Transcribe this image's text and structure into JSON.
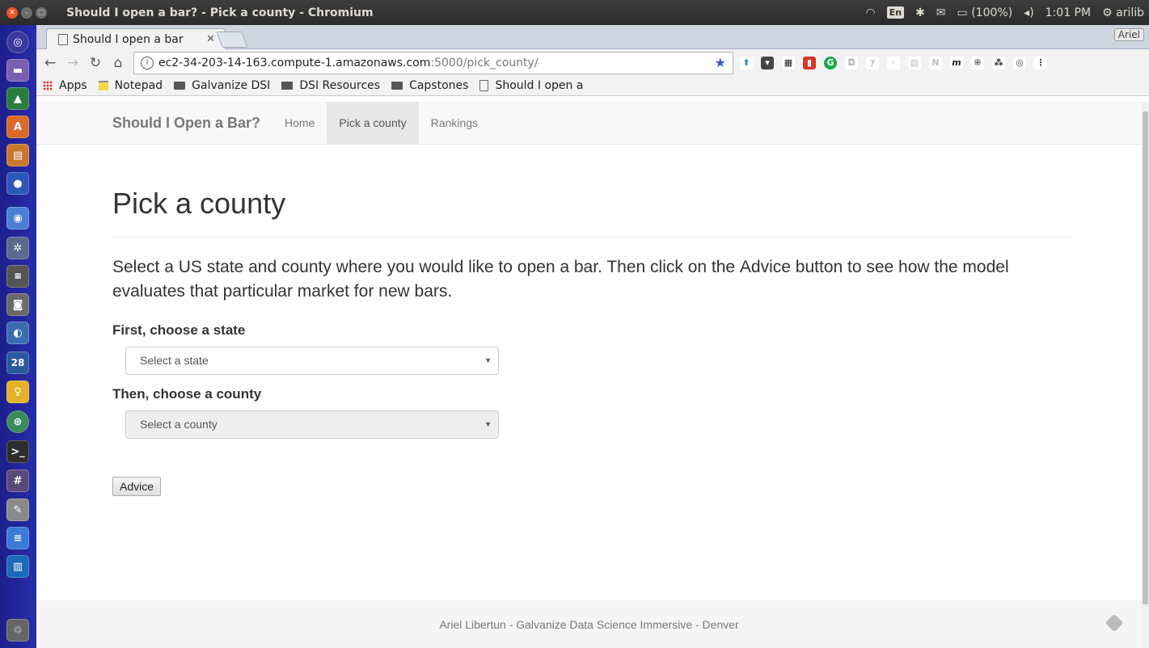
{
  "window": {
    "title": "Should I open a bar? - Pick a county - Chromium",
    "tray": {
      "lang": "En",
      "battery": "(100%)",
      "time": "1:01 PM",
      "user": "arilib"
    }
  },
  "browser": {
    "tab_title": "Should I open a bar",
    "profile": "Ariel",
    "url_host": "ec2-34-203-14-163.compute-1.amazonaws.com",
    "url_path": ":5000/pick_county/",
    "bookmarks": [
      {
        "label": "Apps"
      },
      {
        "label": "Notepad"
      },
      {
        "label": "Galvanize DSI"
      },
      {
        "label": "DSI Resources"
      },
      {
        "label": "Capstones"
      },
      {
        "label": "Should I open a"
      }
    ]
  },
  "site": {
    "brand": "Should I Open a Bar?",
    "nav": [
      {
        "label": "Home"
      },
      {
        "label": "Pick a county"
      },
      {
        "label": "Rankings"
      }
    ]
  },
  "main": {
    "title": "Pick a county",
    "lead_before": "Select a US state and county where you would like to open a bar. Then click on the ",
    "lead_bold": "Advice",
    "lead_after": " button to see how the model evaluates that particular market for new bars.",
    "state_label": "First, choose a state",
    "state_placeholder": "Select a state",
    "county_label": "Then, choose a county",
    "county_placeholder": "Select a county",
    "advice_button": "Advice"
  },
  "footer": {
    "text": "Ariel Libertun - Galvanize Data Science Immersive - Denver"
  },
  "launcher_icons": [
    "dash-icon",
    "files-icon",
    "drive-icon",
    "software-center-icon",
    "archive-icon",
    "firefox-icon",
    "chromium-icon",
    "settings-icon",
    "keyboard-icon",
    "screenshot-icon",
    "remmina-icon",
    "calendar-icon",
    "keep-icon",
    "network-icon",
    "terminal-icon",
    "hashtag-icon",
    "text-editor-icon",
    "docs-icon",
    "trello-icon",
    "trash-icon"
  ]
}
